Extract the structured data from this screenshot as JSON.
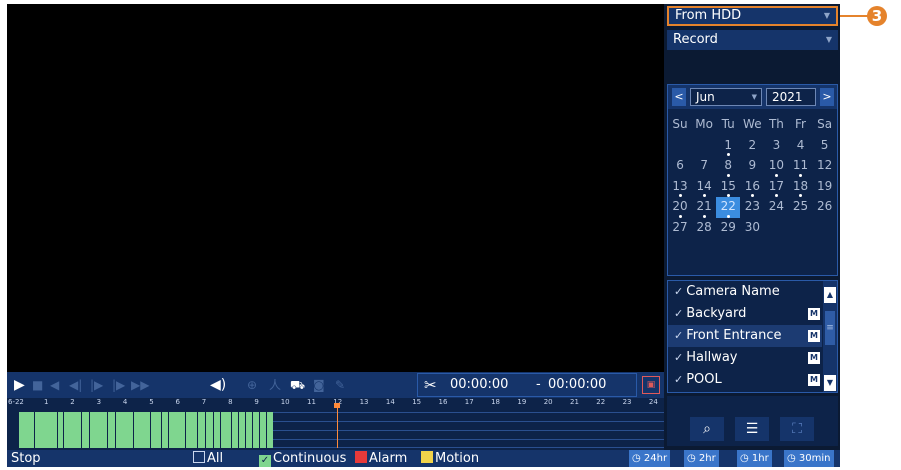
{
  "right_panel": {
    "source": "From HDD",
    "record_type": "Record",
    "calendar": {
      "month": "Jun",
      "year": "2021",
      "prev": "<",
      "next": ">",
      "weekdays": [
        "Su",
        "Mo",
        "Tu",
        "We",
        "Th",
        "Fr",
        "Sa"
      ],
      "weeks": [
        [
          "",
          "",
          "1",
          "2",
          "3",
          "4",
          "5"
        ],
        [
          "6",
          "7",
          "8",
          "9",
          "10",
          "11",
          "12"
        ],
        [
          "13",
          "14",
          "15",
          "16",
          "17",
          "18",
          "19"
        ],
        [
          "20",
          "21",
          "22",
          "23",
          "24",
          "25",
          "26"
        ],
        [
          "27",
          "28",
          "29",
          "30",
          "",
          "",
          ""
        ]
      ],
      "days_with_records": [
        "1",
        "8",
        "10",
        "11",
        "13",
        "14",
        "15",
        "16",
        "17",
        "18",
        "20",
        "21",
        "22"
      ],
      "selected_day": "22"
    },
    "cameras": {
      "header": "Camera Name",
      "items": [
        "Backyard",
        "Front Entrance",
        "Hallway",
        "POOL"
      ],
      "badge": "M"
    }
  },
  "playback": {
    "start_time": "00:00:00",
    "separator": "-",
    "end_time": "00:00:00"
  },
  "timeline": {
    "date_label": "6-22",
    "hours": [
      "1",
      "2",
      "3",
      "4",
      "5",
      "6",
      "7",
      "8",
      "9",
      "10",
      "11",
      "12",
      "13",
      "14",
      "15",
      "16",
      "17",
      "18",
      "19",
      "20",
      "21",
      "22",
      "23",
      "24"
    ],
    "recorded_until_hour": 10,
    "cursor_hour": 12
  },
  "status_bar": {
    "state": "Stop",
    "legend": {
      "all": "All",
      "continuous": "Continuous",
      "alarm": "Alarm",
      "motion": "Motion"
    },
    "zoom": [
      "24hr",
      "2hr",
      "1hr",
      "30min"
    ]
  },
  "callout": "3",
  "colors": {
    "continuous": "#7fd68f",
    "alarm": "#e83a3a",
    "motion": "#f2d34a",
    "highlight": "#e5832c"
  }
}
